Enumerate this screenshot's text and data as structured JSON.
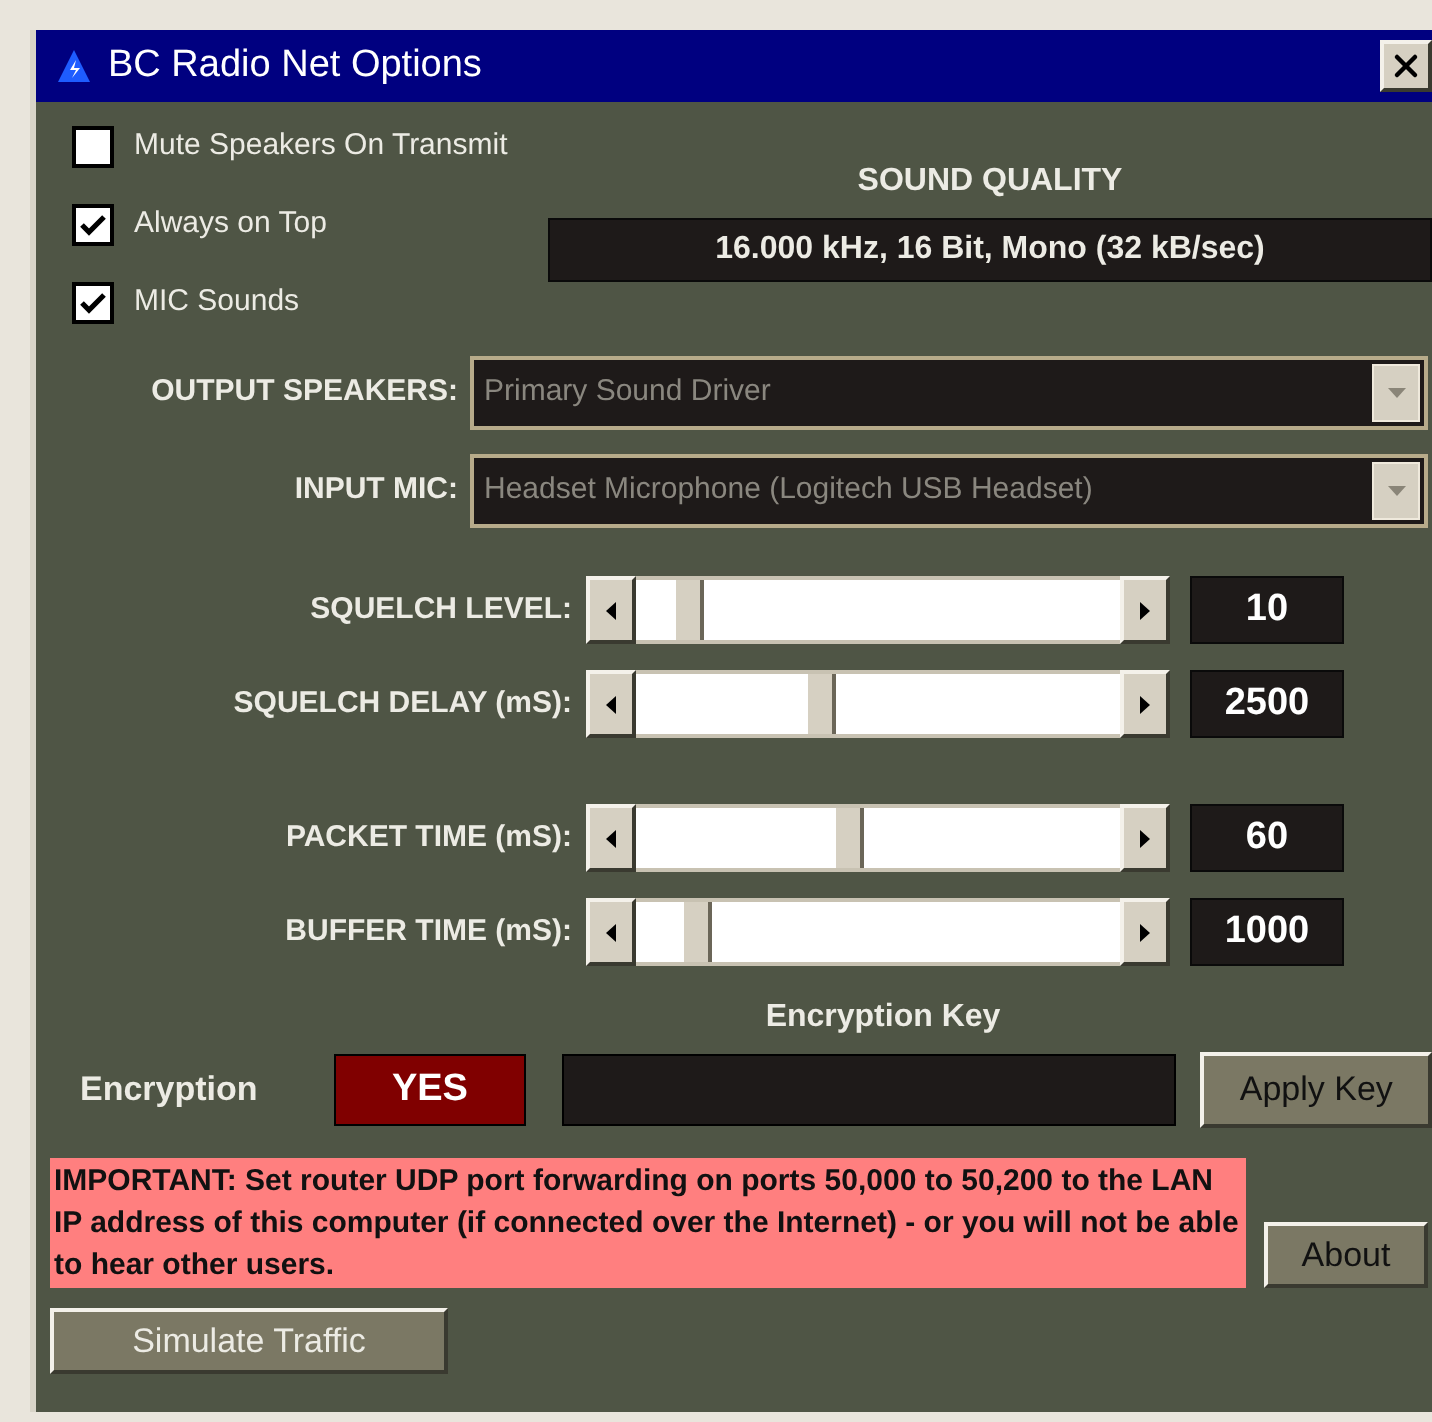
{
  "window": {
    "title": "BC Radio Net Options"
  },
  "checkboxes": [
    {
      "label": "Mute Speakers On Transmit",
      "checked": false
    },
    {
      "label": "Always on Top",
      "checked": true
    },
    {
      "label": "MIC Sounds",
      "checked": true
    }
  ],
  "sound_quality": {
    "label": "SOUND QUALITY",
    "value": "16.000 kHz, 16 Bit, Mono (32 kB/sec)"
  },
  "dropdowns": [
    {
      "label": "OUTPUT SPEAKERS:",
      "value": "Primary Sound Driver"
    },
    {
      "label": "INPUT MIC:",
      "value": "Headset Microphone (Logitech USB Headset)"
    }
  ],
  "slider_groups": [
    [
      {
        "label": "SQUELCH LEVEL:",
        "level": 0.08,
        "value": "10"
      },
      {
        "label": "SQUELCH DELAY (mS):",
        "level": 0.38,
        "value": "2500"
      }
    ],
    [
      {
        "label": "PACKET TIME (mS):",
        "level": 0.44,
        "value": "60"
      },
      {
        "label": "BUFFER TIME (mS):",
        "level": 0.1,
        "value": "1000"
      }
    ]
  ],
  "encryption": {
    "label": "Encryption",
    "value": "YES",
    "key_label": "Encryption Key",
    "apply_button": "Apply Key"
  },
  "notice": "IMPORTANT: Set router UDP port forwarding on ports 50,000 to 50,200 to the LAN IP address of this computer (if connected over the Internet) - or you will not be able to hear other users.",
  "about_button": "About",
  "simulate_button": "Simulate Traffic"
}
